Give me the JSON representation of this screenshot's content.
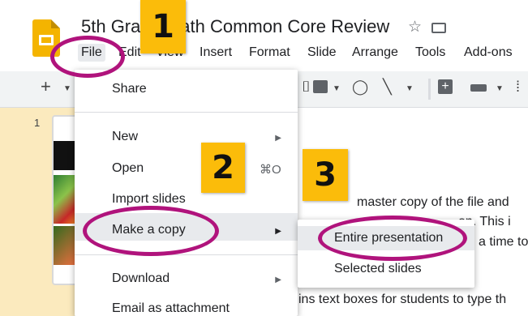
{
  "doc_title": "5th Grade Math Common Core Review",
  "menu": [
    "File",
    "Edit",
    "View",
    "Insert",
    "Format",
    "Slide",
    "Arrange",
    "Tools",
    "Add-ons"
  ],
  "filmstrip": {
    "slide_number": "1"
  },
  "slide_body": {
    "line1": "master copy of the file and",
    "line2": "on. This i",
    "line3": "a time to",
    "line4": "ins text boxes for students to type th"
  },
  "file_menu": {
    "share": "Share",
    "new": "New",
    "open": "Open",
    "open_shortcut": "⌘O",
    "import_slides": "Import slides",
    "make_a_copy": "Make a copy",
    "download": "Download",
    "email_as_attachment": "Email as attachment"
  },
  "make_copy_submenu": {
    "entire_presentation": "Entire presentation",
    "selected_slides": "Selected slides"
  },
  "callouts": [
    "1",
    "2",
    "3"
  ],
  "colors": {
    "badge": "#fbbc0a",
    "oval": "#b0137c",
    "logo": "#f4b400",
    "filmstrip_bg": "#fbeabe"
  }
}
